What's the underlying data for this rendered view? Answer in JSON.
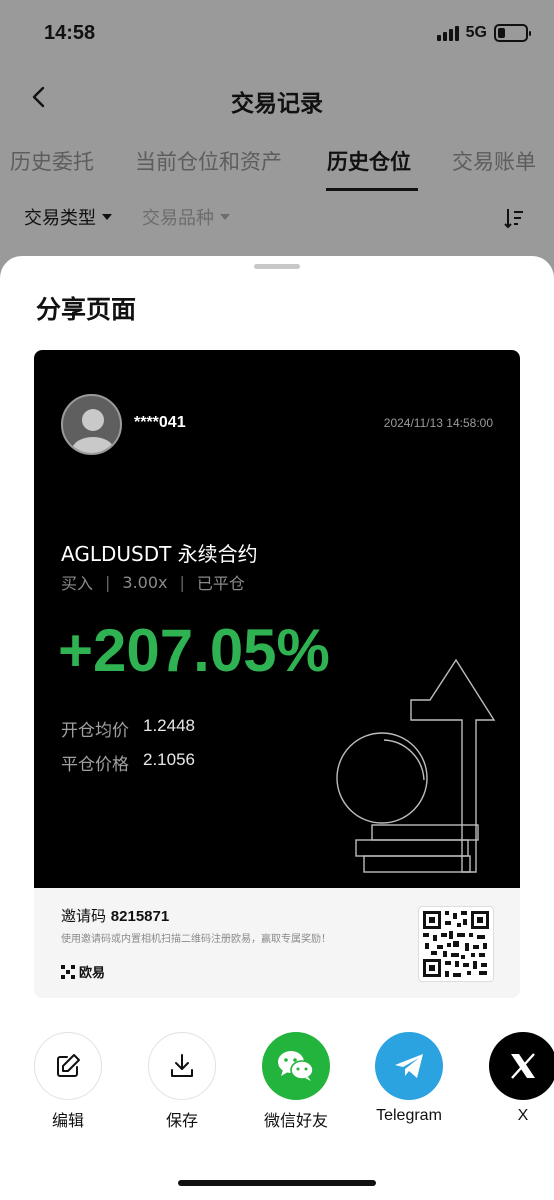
{
  "status_bar": {
    "time": "14:58",
    "network": "5G"
  },
  "nav": {
    "title": "交易记录"
  },
  "tabs": [
    {
      "label": "历史委托"
    },
    {
      "label": "当前仓位和资产"
    },
    {
      "label": "历史仓位"
    },
    {
      "label": "交易账单"
    }
  ],
  "filters": {
    "trade_type": "交易类型",
    "instrument": "交易品种"
  },
  "sheet": {
    "title": "分享页面",
    "card": {
      "username": "****041",
      "timestamp": "2024/11/13 14:58:00",
      "pair": "AGLDUSDT 永续合约",
      "side": "买入",
      "leverage": "3.00x",
      "status": "已平仓",
      "pnl": "+207.05%",
      "open_price_label": "开仓均价",
      "open_price": "1.2448",
      "close_price_label": "平仓价格",
      "close_price": "2.1056",
      "invite_label": "邀请码",
      "invite_code": "8215871",
      "invite_desc": "使用邀请码或内置相机扫描二维码注册欧易，赢取专属奖励！",
      "brand": "欧易"
    },
    "share_options": [
      {
        "label": "编辑",
        "icon": "edit-icon"
      },
      {
        "label": "保存",
        "icon": "download-icon"
      },
      {
        "label": "微信好友",
        "icon": "wechat-icon"
      },
      {
        "label": "Telegram",
        "icon": "telegram-icon"
      },
      {
        "label": "X",
        "icon": "x-icon"
      }
    ]
  },
  "colors": {
    "profit": "#2fb352",
    "wechat": "#22b43c",
    "telegram": "#2aa3e0"
  }
}
